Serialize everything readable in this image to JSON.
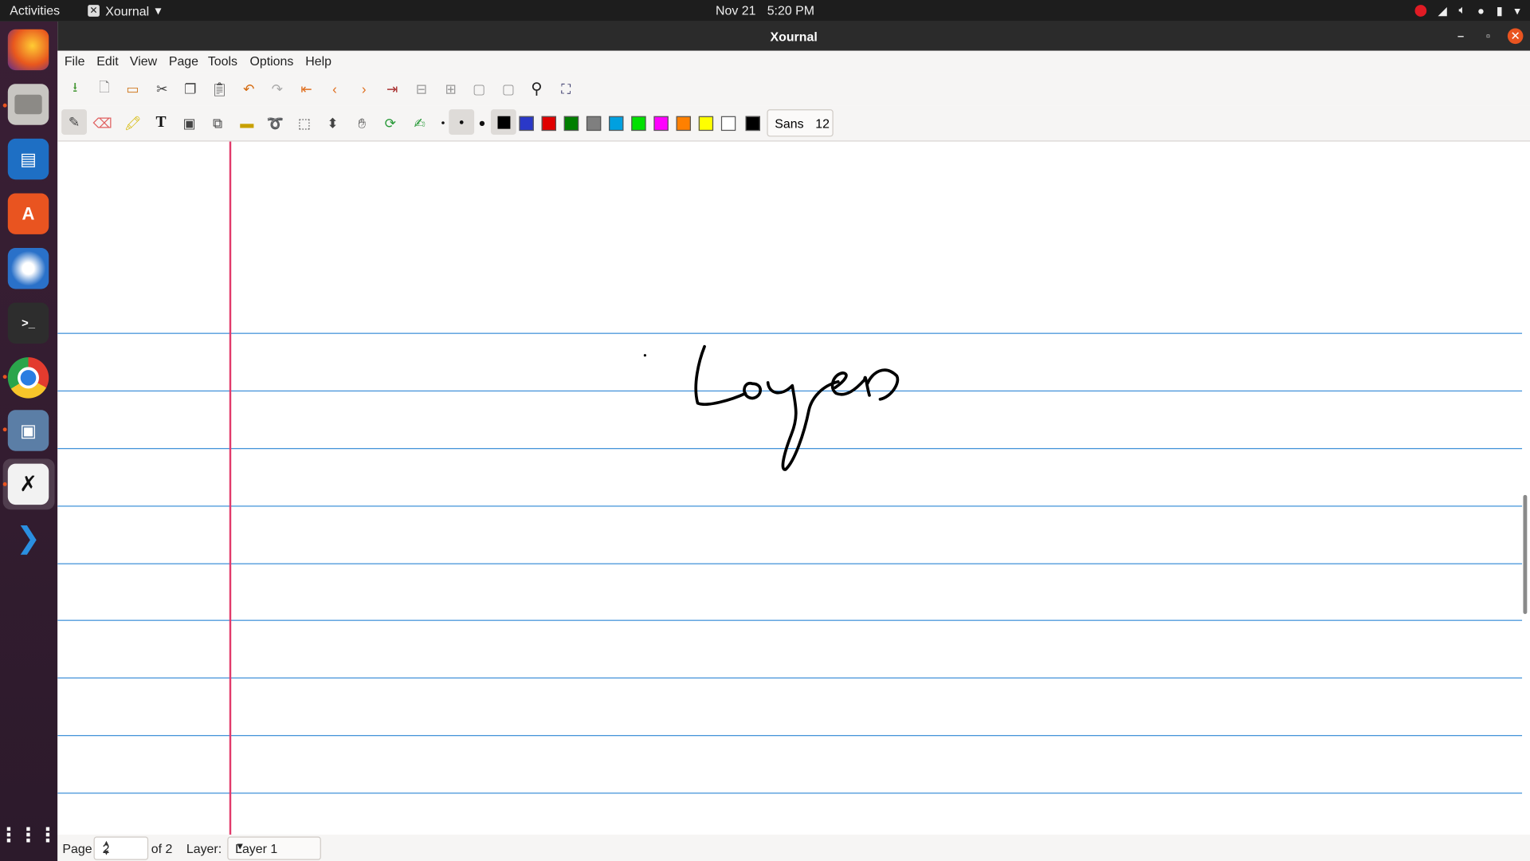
{
  "topbar": {
    "activities": "Activities",
    "app_name": "Xournal",
    "date": "Nov 21",
    "time": "5:20 PM"
  },
  "window": {
    "title": "Xournal"
  },
  "menu": {
    "file": "File",
    "edit": "Edit",
    "view": "View",
    "page": "Page",
    "tools": "Tools",
    "options": "Options",
    "help": "Help"
  },
  "font": {
    "name": "Sans",
    "size": "12"
  },
  "colors": {
    "swatches": [
      "#000000",
      "#2a38c8",
      "#e00000",
      "#007f00",
      "#7f7f7f",
      "#00a0e0",
      "#00e000",
      "#ff00ff",
      "#ff8000",
      "#ffff00",
      "#ffffff",
      "#000000"
    ]
  },
  "statusbar": {
    "page_label": "Page",
    "page_value": "2",
    "of_pages": "of 2",
    "layer_label": "Layer:",
    "layer_value": "Layer 1"
  },
  "canvas": {
    "handwriting": "Loyer"
  }
}
